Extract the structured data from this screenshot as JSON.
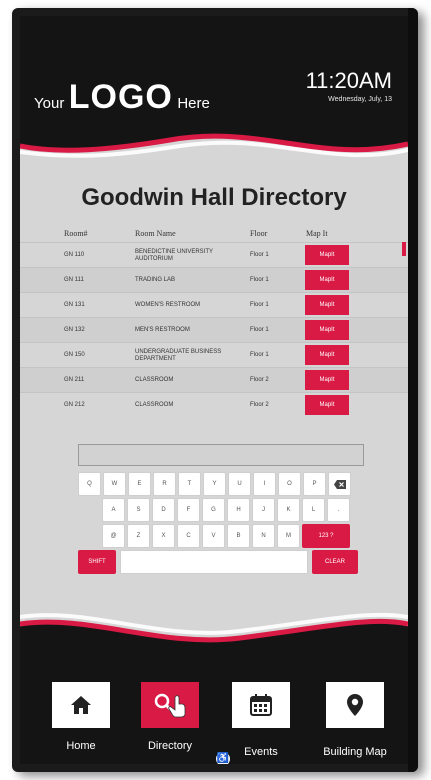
{
  "header": {
    "logo_pre": "Your",
    "logo_main": "LOGO",
    "logo_post": "Here",
    "time": "11:20AM",
    "date": "Wednesday, July, 13"
  },
  "directory": {
    "title": "Goodwin Hall Directory",
    "columns": [
      "Room#",
      "Room Name",
      "Floor",
      "Map It"
    ],
    "rows": [
      {
        "room": "GN 110",
        "name": "BENEDICTINE UNIVERSITY AUDITORIUM",
        "floor": "Floor 1",
        "map": "MapIt"
      },
      {
        "room": "GN 111",
        "name": "TRADING LAB",
        "floor": "Floor 1",
        "map": "MapIt"
      },
      {
        "room": "GN 131",
        "name": "WOMEN'S RESTROOM",
        "floor": "Floor 1",
        "map": "MapIt"
      },
      {
        "room": "GN 132",
        "name": "MEN'S RESTROOM",
        "floor": "Floor 1",
        "map": "MapIt"
      },
      {
        "room": "GN 150",
        "name": "UNDERGRADUATE BUSINESS DEPARTMENT",
        "floor": "Floor 1",
        "map": "MapIt"
      },
      {
        "room": "GN 211",
        "name": "CLASSROOM",
        "floor": "Floor 2",
        "map": "MapIt"
      },
      {
        "room": "GN 212",
        "name": "CLASSROOM",
        "floor": "Floor 2",
        "map": "MapIt"
      }
    ]
  },
  "search": {
    "value": ""
  },
  "keyboard": {
    "row1": [
      "Q",
      "W",
      "E",
      "R",
      "T",
      "Y",
      "U",
      "I",
      "O",
      "P"
    ],
    "row2": [
      "A",
      "S",
      "D",
      "F",
      "G",
      "H",
      "J",
      "K",
      "L",
      "."
    ],
    "row3": [
      "@",
      "Z",
      "X",
      "C",
      "V",
      "B",
      "N",
      "M"
    ],
    "numbers_label": "123 ?",
    "shift_label": "SHIFT",
    "clear_label": "CLEAR",
    "backspace_icon": "backspace-icon"
  },
  "nav": [
    {
      "label": "Home",
      "icon": "home-icon",
      "active": false
    },
    {
      "label": "Directory",
      "icon": "search-icon",
      "active": true
    },
    {
      "label": "Events",
      "icon": "calendar-icon",
      "active": false
    },
    {
      "label": "Building Map",
      "icon": "map-pin-icon",
      "active": false
    }
  ],
  "accessibility_icon": "wheelchair-icon",
  "colors": {
    "accent": "#d91a45",
    "dark": "#141414",
    "panel": "#d6d6d6"
  }
}
